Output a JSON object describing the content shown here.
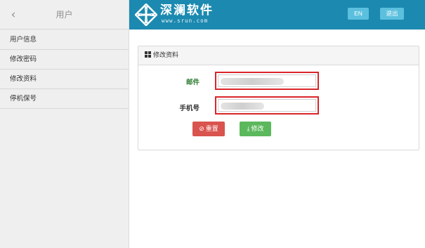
{
  "sidebar": {
    "back_icon": "chevron-left-icon",
    "title": "用户",
    "items": [
      {
        "label": "用户信息"
      },
      {
        "label": "修改密码"
      },
      {
        "label": "修改资料"
      },
      {
        "label": "停机保号"
      }
    ]
  },
  "header": {
    "logo_text": "深澜软件",
    "logo_sub": "www.srun.com",
    "lang_button": "EN",
    "logout_button": "退出",
    "bar_color": "#1c8ab0",
    "button_color": "#5bc0de"
  },
  "panel": {
    "title": "修改资料",
    "title_icon": "grid-icon",
    "fields": {
      "email_label": "邮件",
      "phone_label": "手机号",
      "email_value": "",
      "phone_value": ""
    },
    "buttons": {
      "reset_label": "重置",
      "reset_icon": "ban-icon",
      "save_label": "修改",
      "save_icon": "download-icon",
      "reset_color": "#d9534f",
      "save_color": "#5cb85c"
    },
    "highlight_color": "#d9262b"
  }
}
